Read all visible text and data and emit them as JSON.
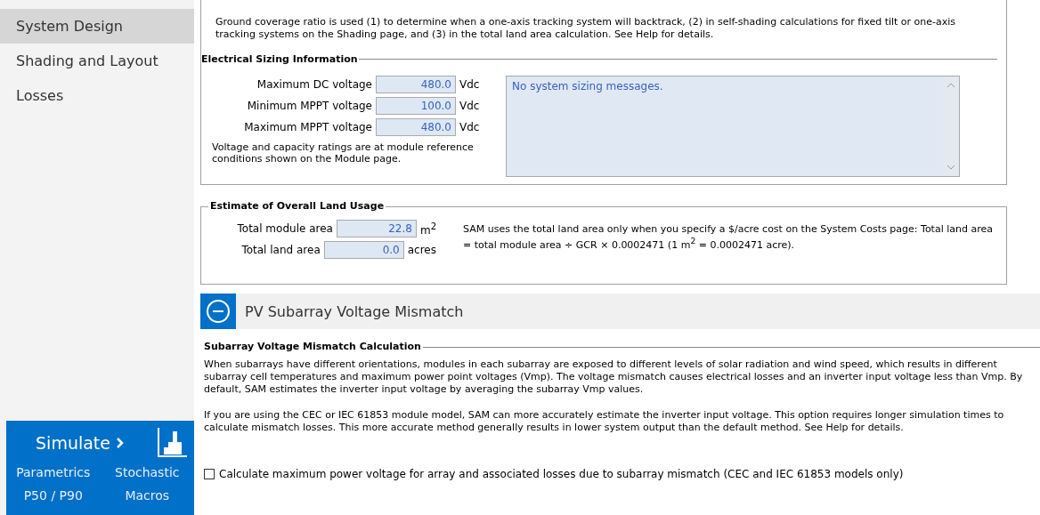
{
  "sidebar": {
    "items": [
      {
        "label": "System Design",
        "selected": true
      },
      {
        "label": "Shading and Layout",
        "selected": false
      },
      {
        "label": "Losses",
        "selected": false
      }
    ],
    "simulate": {
      "label": "Simulate",
      "links": [
        "Parametrics",
        "Stochastic",
        "P50 / P90",
        "Macros"
      ]
    }
  },
  "tracking_note": "Ground coverage ratio is used (1) to determine when a one-axis tracking system will backtrack, (2) in self-shading calculations for fixed tilt or one-axis tracking systems on the Shading page, and (3) in the total land area calculation. See Help for details.",
  "electrical_sizing": {
    "title": "Electrical Sizing Information",
    "fields": [
      {
        "label": "Maximum DC voltage",
        "value": "480.0",
        "unit": "Vdc"
      },
      {
        "label": "Minimum MPPT voltage",
        "value": "100.0",
        "unit": "Vdc"
      },
      {
        "label": "Maximum MPPT voltage",
        "value": "480.0",
        "unit": "Vdc"
      }
    ],
    "note": "Voltage and capacity ratings are at module reference conditions shown on the Module page.",
    "messages": "No system sizing messages."
  },
  "land_usage": {
    "title": "Estimate of Overall Land Usage",
    "fields": [
      {
        "label": "Total module area",
        "value": "22.8",
        "unit": "m$^{2}$"
      },
      {
        "label": "Total land area",
        "value": "0.0",
        "unit": "acres"
      }
    ],
    "note": "SAM uses the total land area only when you specify a $/acre cost on the System Costs page: Total land area = total module area ÷ GCR × 0.0002471 (1 m$^{2}$ = 0.0002471 acre)."
  },
  "mismatch_section": {
    "title": "PV Subarray Voltage Mismatch",
    "expanded": true,
    "group_title": "Subarray Voltage Mismatch Calculation",
    "paragraphs": [
      "When subarrays have different orientations, modules in each subarray are exposed to different levels of solar radiation and wind speed, which results in different subarray cell temperatures and maximum power point voltages (Vmp). The voltage mismatch causes electrical losses and an inverter input voltage less than Vmp. By default, SAM estimates the inverter input voltage by averaging the subarray Vmp values.",
      "If you are using the CEC or IEC 61853 module model, SAM can more accurately estimate the inverter input voltage. This option requires longer simulation times to calculate mismatch losses. This more accurate method generally results in lower system output than the default method. See Help for details."
    ],
    "checkbox": {
      "label": "Calculate maximum power voltage for array and associated losses due to subarray mismatch (CEC and IEC 61853 models only)",
      "checked": false
    }
  }
}
